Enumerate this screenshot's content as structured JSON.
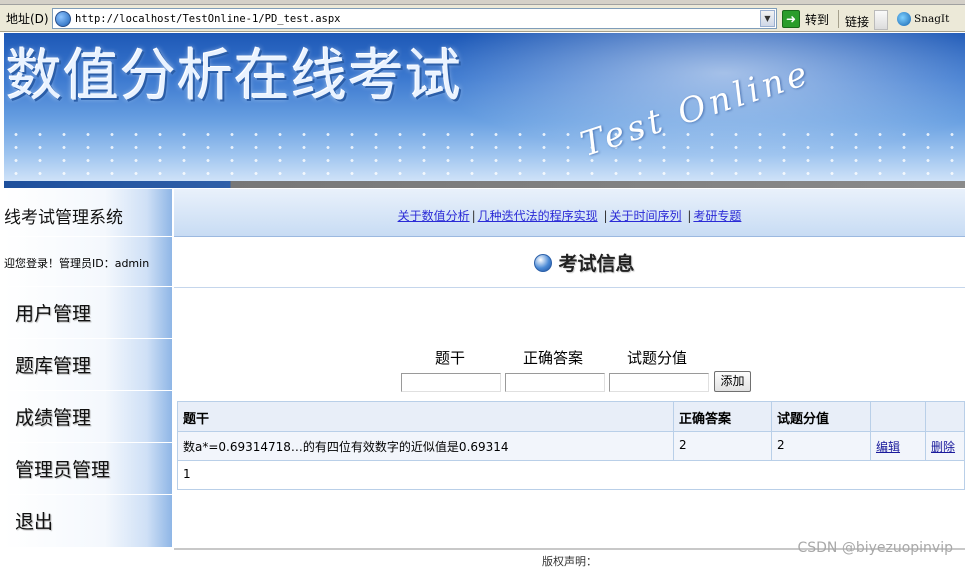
{
  "browser": {
    "address_label": "地址(D)",
    "url": "http://localhost/TestOnline-1/PD_test.aspx",
    "go_label": "转到",
    "links_label": "链接",
    "snagit_label": "SnagIt"
  },
  "banner": {
    "title": "数值分析在线考试",
    "subtitle": "Test Online"
  },
  "sidebar": {
    "system_title": "线考试管理系统",
    "welcome": "迎您登录！管理员ID：admin",
    "items": [
      {
        "label": "用户管理"
      },
      {
        "label": "题库管理"
      },
      {
        "label": "成绩管理"
      },
      {
        "label": "管理员管理"
      },
      {
        "label": "退出"
      }
    ]
  },
  "nav": {
    "links": [
      "关于数值分析",
      "几种迭代法的程序实现",
      "关于时间序列",
      "考研专题"
    ],
    "separator": "|"
  },
  "main": {
    "heading": "考试信息",
    "form": {
      "label_question": "题干",
      "label_answer": "正确答案",
      "label_score": "试题分值",
      "value_question": "",
      "value_answer": "",
      "value_score": "",
      "add_label": "添加"
    },
    "table": {
      "headers": [
        "题干",
        "正确答案",
        "试题分值",
        "",
        ""
      ],
      "rows": [
        {
          "question": "数a*=0.69314718…的有四位有效数字的近似值是0.69314",
          "answer": "2",
          "score": "2",
          "edit": "编辑",
          "delete": "删除"
        }
      ],
      "pager": "1"
    }
  },
  "footer": {
    "copyright": "版权声明："
  },
  "watermark": "CSDN @biyezuopinvip"
}
